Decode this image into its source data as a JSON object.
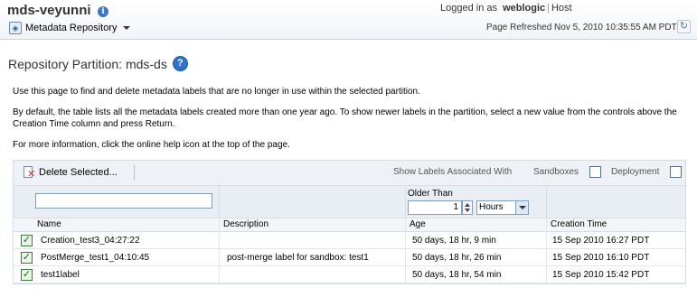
{
  "header": {
    "app_title": "mds-veyunni",
    "menu_label": "Metadata Repository",
    "logged_in_prefix": "Logged in as",
    "user": "weblogic",
    "host_link": "Host",
    "refreshed": "Page Refreshed Nov 5, 2010 10:35:55 AM PDT"
  },
  "page": {
    "title": "Repository Partition: mds-ds",
    "desc1": "Use this page to find and delete metadata labels that are no longer in use within the selected partition.",
    "desc2": "By default, the table lists all the metadata labels created more than one year ago. To show newer labels in the partition, select a new value from the controls above the Creation Time column and press Return.",
    "desc3": "For more information, click the online help icon at the top of the page."
  },
  "toolbar": {
    "delete_label": "Delete Selected...",
    "show_labels": "Show Labels Associated With",
    "sandboxes": "Sandboxes",
    "deployment": "Deployment"
  },
  "filter": {
    "name_value": "",
    "older_than_label": "Older Than",
    "older_than_value": "1",
    "unit_selected": "Hours"
  },
  "table": {
    "columns": [
      "Name",
      "Description",
      "Age",
      "Creation Time"
    ],
    "rows": [
      {
        "checked": true,
        "name": "Creation_test3_04:27:22",
        "description": "",
        "age": "50 days, 18 hr, 9 min",
        "created": "15 Sep 2010 16:27 PDT"
      },
      {
        "checked": true,
        "name": "PostMerge_test1_04:10:45",
        "description": "post-merge label for sandbox: test1",
        "age": "50 days, 18 hr, 26 min",
        "created": "15 Sep 2010 16:10 PDT"
      },
      {
        "checked": true,
        "name": "test1label",
        "description": "",
        "age": "50 days, 18 hr, 54 min",
        "created": "15 Sep 2010 15:42 PDT"
      }
    ]
  },
  "colors": {
    "accent": "#2e73c7",
    "header_bg": "#f1f4f8",
    "toolbar_bg": "#eef1f5",
    "filter_bg": "#e9eef4"
  }
}
